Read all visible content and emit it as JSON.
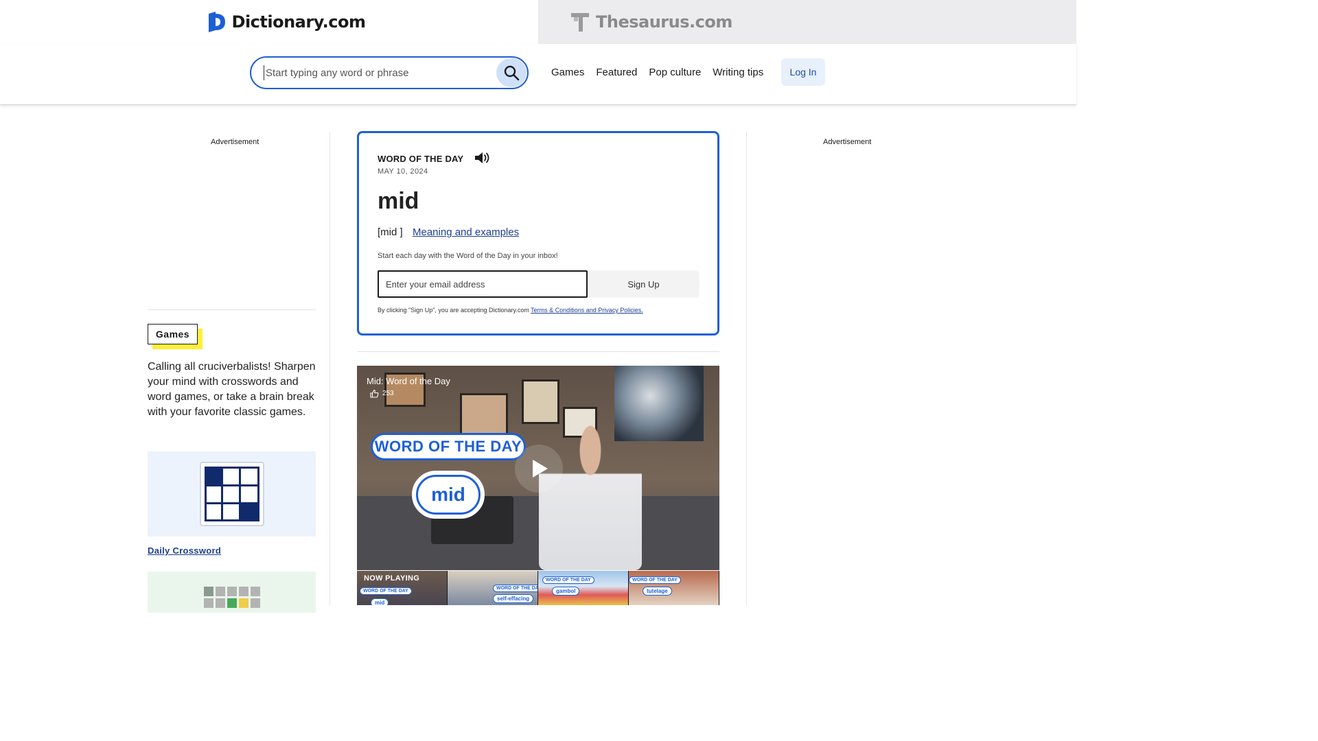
{
  "brands": {
    "dictionary": "Dictionary.com",
    "thesaurus": "Thesaurus.com"
  },
  "search": {
    "placeholder": "Start typing any word or phrase"
  },
  "nav": {
    "items": [
      "Games",
      "Featured",
      "Pop culture",
      "Writing tips"
    ],
    "login": "Log In"
  },
  "ads": {
    "left": "Advertisement",
    "right": "Advertisement"
  },
  "games": {
    "tag": "Games",
    "copy": "Calling all cruciverbalists! Sharpen your mind with crosswords and word games, or take a brain break with your favorite classic games.",
    "crossword_link": "Daily Crossword"
  },
  "wotd": {
    "label": "WORD OF THE DAY",
    "date": "MAY 10, 2024",
    "word": "mid",
    "pronunciation": "[mid ]",
    "meaning_link": "Meaning and examples",
    "prompt": "Start each day with the Word of the Day in your inbox!",
    "email_placeholder": "Enter your email address",
    "signup": "Sign Up",
    "legal_prefix": "By clicking \"Sign Up\", you are accepting Dictionary.com",
    "legal_link": "Terms & Conditions and Privacy Policies."
  },
  "video": {
    "title": "Mid: Word of the Day",
    "likes": "253",
    "overlay_label": "WORD OF THE DAY",
    "overlay_word": "mid",
    "now_playing": "NOW PLAYING",
    "thumbnails": [
      {
        "label": "WORD OF THE DAY",
        "word": "mid"
      },
      {
        "label": "WORD OF THE DAY",
        "word": "self-effacing"
      },
      {
        "label": "WORD OF THE DAY",
        "word": "gambol"
      },
      {
        "label": "WORD OF THE DAY",
        "word": "tutelage"
      }
    ]
  },
  "colors": {
    "accent": "#1d5fd6",
    "link": "#1d3f8f",
    "highlight": "#ffef3a"
  }
}
